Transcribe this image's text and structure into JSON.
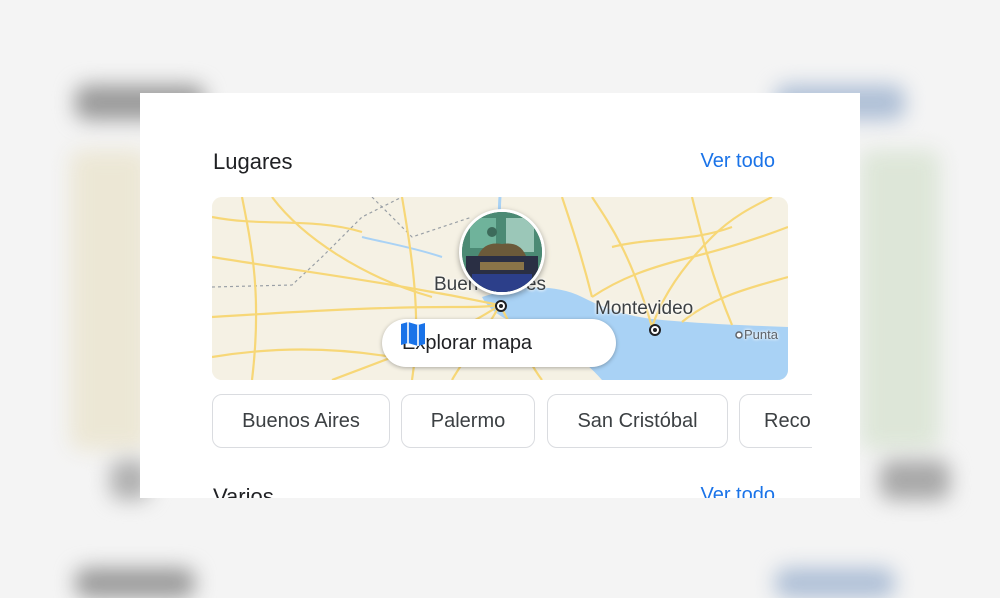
{
  "places": {
    "title": "Lugares",
    "see_all": "Ver todo",
    "map": {
      "labels": [
        "Buenos Aires",
        "Montevideo",
        "Punta"
      ],
      "explore_label": "Explorar mapa",
      "colors": {
        "land": "#f5f1e4",
        "water": "#a9d2f5",
        "road": "#f7d777",
        "boundary": "#9aa0a6"
      }
    },
    "chips": [
      "Buenos Aires",
      "Palermo",
      "San Cristóbal",
      "Reco"
    ]
  },
  "misc": {
    "title": "Varios",
    "see_all": "Ver todo"
  },
  "colors": {
    "accent": "#1a73e8",
    "card": "#ffffff",
    "text": "#202124"
  }
}
